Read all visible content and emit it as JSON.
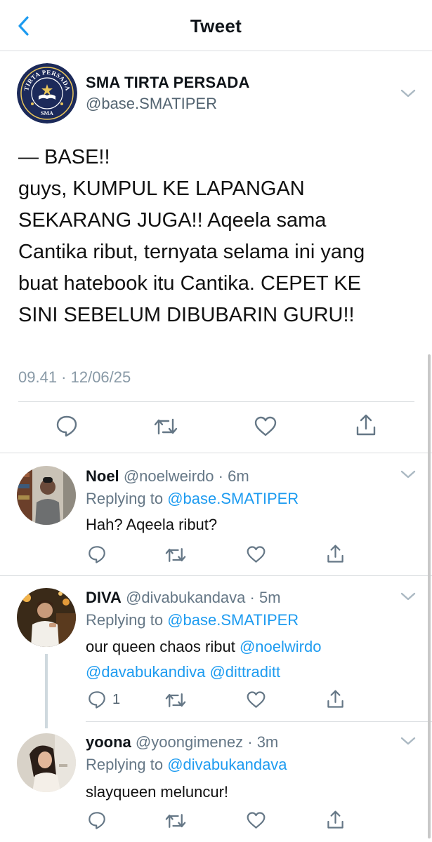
{
  "header": {
    "title": "Tweet",
    "back_icon": "chevron-left-icon"
  },
  "main_tweet": {
    "name": "SMA TIRTA PERSADA",
    "handle": "@base.SMATIPER",
    "avatar_text_top": "TIRTA PERSADA",
    "avatar_text_bottom": "SMA",
    "text_lines": [
      "— BASE!!",
      "guys, KUMPUL KE LAPANGAN",
      "SEKARANG JUGA!! Aqeela sama",
      "Cantika ribut, ternyata selama ini yang",
      "buat hatebook itu Cantika. CEPET KE",
      "SINI SEBELUM DIBUBARIN GURU!!"
    ],
    "timestamp": "09.41 · 12/06/25"
  },
  "replies": [
    {
      "name": "Noel",
      "handle": "@noelweirdo",
      "time": "· 6m",
      "replying_prefix": "Replying to",
      "replying_to": "@base.SMATIPER",
      "text": "Hah? Aqeela ribut?"
    },
    {
      "name": "DIVA",
      "handle": "@divabukandava",
      "time": "· 5m",
      "replying_prefix": "Replying to",
      "replying_to": "@base.SMATIPER",
      "text_plain": "our queen chaos ribut ",
      "mentions": [
        "@noelwirdo",
        "@davabukandiva",
        "@dittraditt"
      ],
      "reply_count": "1"
    },
    {
      "name": "yoona",
      "handle": "@yoongimenez",
      "time": "· 3m",
      "replying_prefix": "Replying to",
      "replying_to": "@divabukandava",
      "text": "slayqueen meluncur!"
    }
  ],
  "colors": {
    "accent": "#1d9bf0",
    "muted": "#657786",
    "divider": "#dadde0",
    "navy": "#1c2a5a"
  }
}
